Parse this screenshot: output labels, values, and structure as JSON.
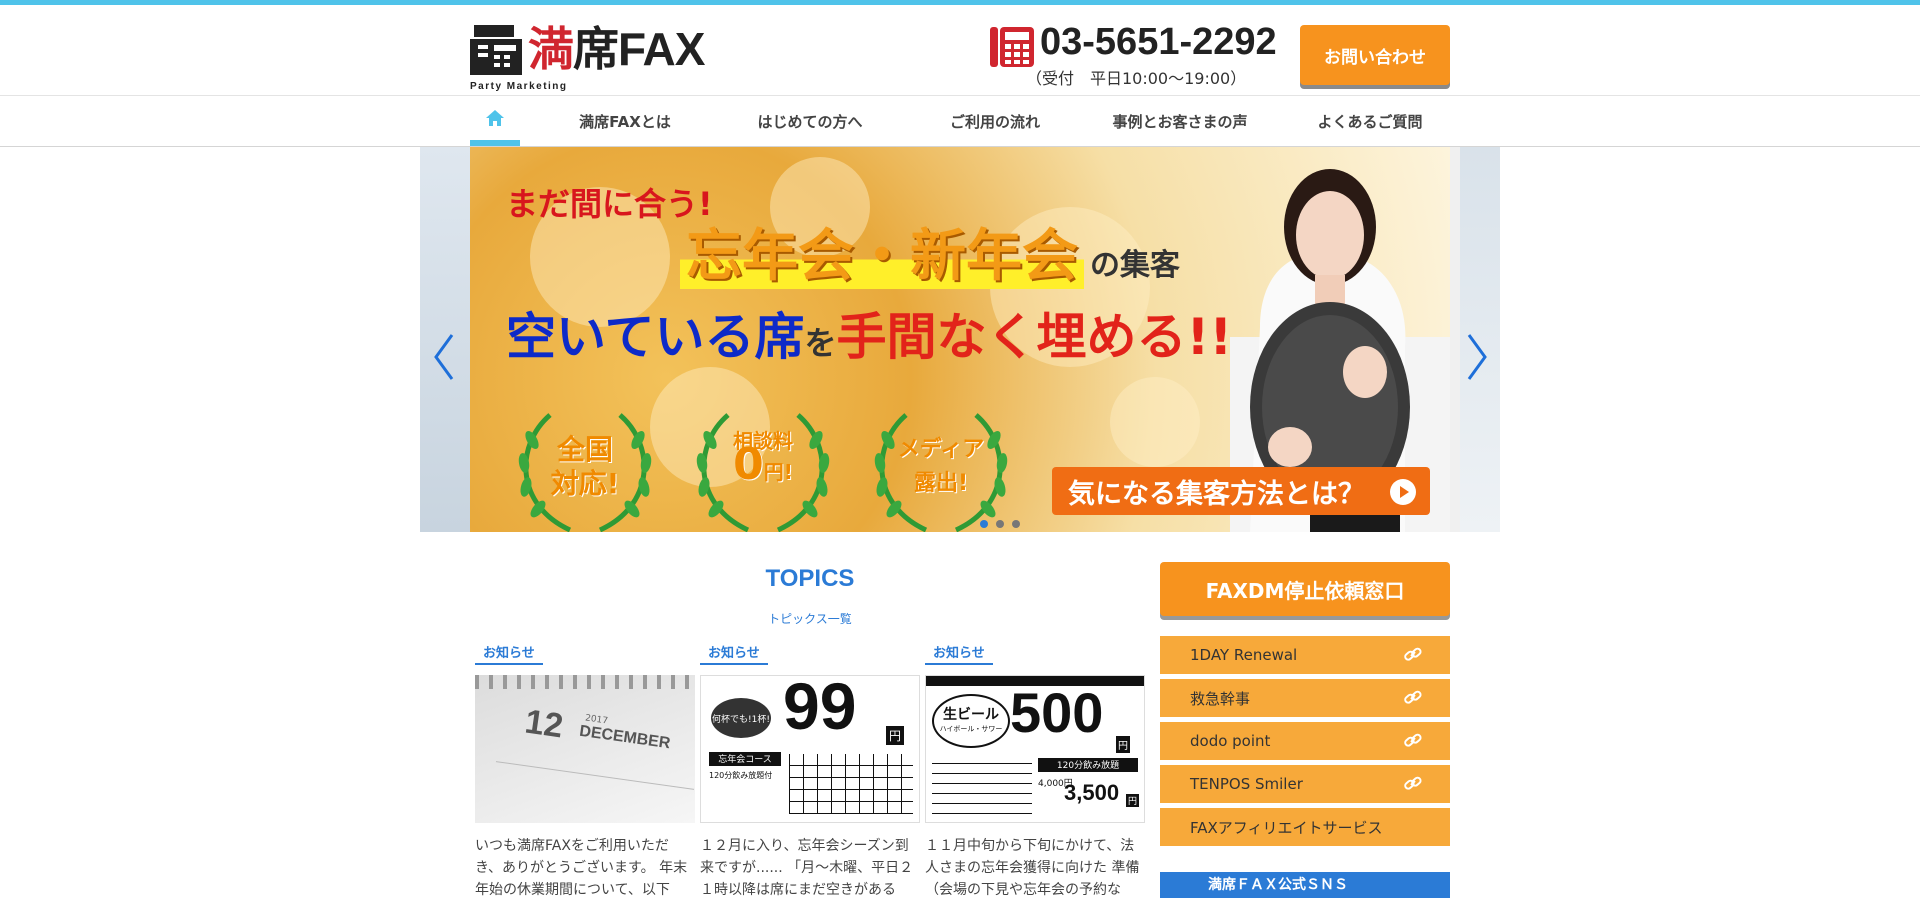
{
  "header": {
    "logo": {
      "brand_mark": "満",
      "brand_mid": "席",
      "brand_tail": "FAX",
      "tagline": "Party Marketing"
    },
    "phone": {
      "number": "03-5651-2292",
      "hours": "（受付　平日10:00〜19:00）"
    },
    "contact_button": "お問い合わせ"
  },
  "nav": {
    "home_icon": "home-icon",
    "items": [
      {
        "label": "満席FAXとは"
      },
      {
        "label": "はじめての方へ"
      },
      {
        "label": "ご利用の流れ"
      },
      {
        "label": "事例とお客さまの声"
      },
      {
        "label": "よくあるご質問"
      }
    ]
  },
  "hero": {
    "line1": "まだ間に合う!",
    "line2": "忘年会・新年会",
    "line2_suffix": "の集客",
    "line3_a": "空いている席",
    "line3_b": "を",
    "line3_c": "手間なく埋める!!",
    "badges": [
      {
        "line1": "全国",
        "line2": "対応!"
      },
      {
        "line1": "相談料",
        "big": "0",
        "line2": "円!"
      },
      {
        "line1": "メディア",
        "line2": "露出!"
      }
    ],
    "cta": "気になる集客方法とは？",
    "slide_count": 3,
    "active_slide": 1
  },
  "topics": {
    "title": "TOPICS",
    "link": "トピックス一覧",
    "cards": [
      {
        "tag": "お知らせ",
        "text": "いつも満席FAXをご利用いただき、ありがとうございます。 年末年始の休業期間について、以下",
        "thumb": {
          "num": "12",
          "year": "2017",
          "month": "DECEMBER"
        }
      },
      {
        "tag": "お知らせ",
        "text": "１２月に入り、忘年会シーズン到来ですが...... 「月〜木曜、平日２１時以降は席にまだ空きがある",
        "thumb": {
          "badge": "何杯でも!1杯!",
          "price": "99",
          "yen": "円",
          "course": "忘年会コース",
          "plan": "120分飲み放題付"
        }
      },
      {
        "tag": "お知らせ",
        "text": "１１月中旬から下旬にかけて、法人さまの忘年会獲得に向けた 準備（会場の下見や忘年会の予約な",
        "thumb": {
          "badge": "生ビール",
          "badge_sub": "ハイボール・サワー",
          "price": "500",
          "yen": "円",
          "plan": "120分飲み放題",
          "price2": "3,500",
          "price2_yen": "円",
          "price_small": "4,000円"
        }
      }
    ]
  },
  "sidebar": {
    "stop_button": "FAXDM停止依頼窓口",
    "links": [
      {
        "label": "1DAY Renewal",
        "external": true
      },
      {
        "label": "救急幹事",
        "external": true
      },
      {
        "label": "dodo point",
        "external": true
      },
      {
        "label": "TENPOS Smiler",
        "external": true
      },
      {
        "label": "FAXアフィリエイトサービス",
        "external": false
      }
    ],
    "sns_title": "満席ＦＡＸ公式ＳＮＳ"
  },
  "colors": {
    "accent_blue": "#2b7bd6",
    "orange": "#f7931e",
    "top_bar": "#4fc3ea",
    "brand_red": "#d0262f"
  }
}
